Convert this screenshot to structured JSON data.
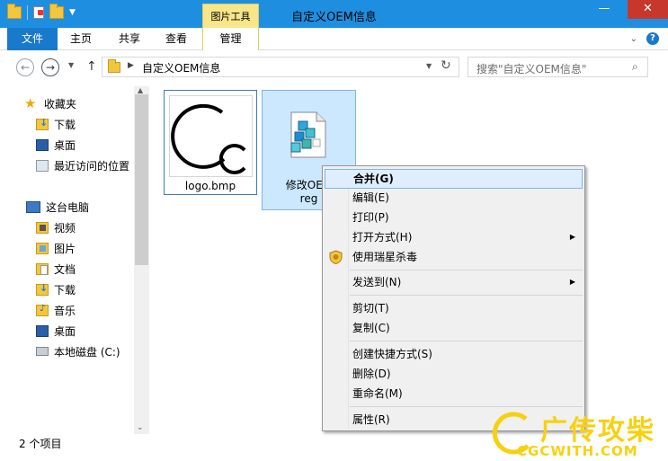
{
  "window": {
    "title": "自定义OEM信息",
    "tools_tab": "图片工具"
  },
  "ribbon": {
    "tabs": [
      "文件",
      "主页",
      "共享",
      "查看",
      "管理"
    ]
  },
  "address": {
    "path": "自定义OEM信息",
    "search_placeholder": "搜索\"自定义OEM信息\""
  },
  "sidebar": {
    "favorites_label": "收藏夹",
    "favorites": [
      "下载",
      "桌面",
      "最近访问的位置"
    ],
    "pc_label": "这台电脑",
    "pc_items": [
      "视频",
      "图片",
      "文档",
      "下载",
      "音乐",
      "桌面",
      "本地磁盘 (C:)"
    ]
  },
  "files": [
    {
      "name": "logo.bmp"
    },
    {
      "name": "修改OEM\nreg"
    }
  ],
  "status": {
    "count": "2 个项目"
  },
  "context_menu": {
    "items": [
      "合并(G)",
      "编辑(E)",
      "打印(P)",
      "打开方式(H)",
      "使用瑞星杀毒",
      "发送到(N)",
      "剪切(T)",
      "复制(C)",
      "创建快捷方式(S)",
      "删除(D)",
      "重命名(M)",
      "属性(R)"
    ]
  },
  "watermark": {
    "big": "广传攻柴",
    "small": "CGCWITH.COM"
  }
}
